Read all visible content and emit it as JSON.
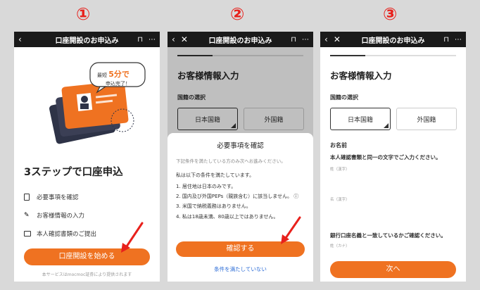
{
  "step_numbers": [
    "①",
    "②",
    "③"
  ],
  "nav_title": "口座開設のお申込み",
  "screen1": {
    "bubble_line1": "最短",
    "bubble_highlight": "5分で",
    "bubble_line2": "申込完了！",
    "headline": "3ステップで口座申込",
    "steps": [
      "必要事項を確認",
      "お客様情報の入力",
      "本人確認書類のご提出"
    ],
    "start_button": "口座開設を始める",
    "footer": "本サービスはmocmoc証券により提供されます"
  },
  "screen2": {
    "heading": "お客様情報入力",
    "nationality_label": "国籍の選択",
    "nat_jp": "日本国籍",
    "nat_foreign": "外国籍",
    "modal_title": "必要事項を確認",
    "modal_intro": "下記条件を満たしている方のみ次へお進みください。",
    "conditions_lead": "私は以下の条件を満たしています。",
    "conditions": [
      "1. 居住地は日本のみです。",
      "2. 国内及び外国PEPs（親族含む）に該当しません。 ⓘ",
      "3. 米国で納税義務はありません。",
      "4. 私は18歳未満、80歳以上ではありません。"
    ],
    "confirm_button": "確認する",
    "decline_link": "条件を満たしていない"
  },
  "screen3": {
    "heading": "お客様情報入力",
    "nationality_label": "国籍の選択",
    "nat_jp": "日本国籍",
    "nat_foreign": "外国籍",
    "name_label": "お名前",
    "name_note": "本人確認書類と同一の文字でご入力ください。",
    "sei_kanji": "姓（漢字）",
    "mei_kanji": "名（漢字）",
    "bank_note": "銀行口座名義と一致しているかご確認ください。",
    "sei_kana": "姓（カナ）",
    "next_button": "次へ"
  },
  "colors": {
    "accent": "#ef7221",
    "arrow": "#e8211c",
    "nav": "#1a1a1a"
  }
}
